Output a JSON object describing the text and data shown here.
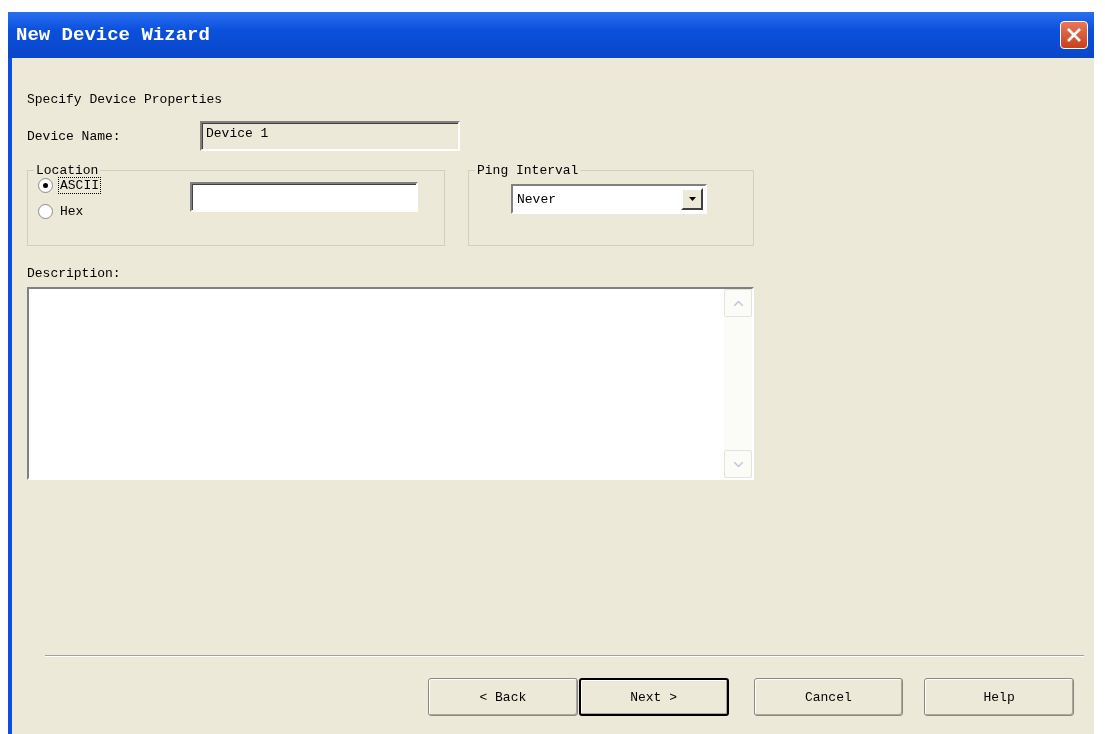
{
  "window": {
    "title": "New Device Wizard"
  },
  "heading": "Specify Device Properties",
  "device_name": {
    "label": "Device Name:",
    "value": "Device 1",
    "disabled": true
  },
  "location": {
    "label": "Location",
    "options": [
      {
        "label": "ASCII",
        "selected": true,
        "focused": true
      },
      {
        "label": "Hex",
        "selected": false,
        "focused": false
      }
    ]
  },
  "ping_interval": {
    "label": "Ping Interval",
    "value": "Never"
  },
  "description": {
    "label": "Description:"
  },
  "buttons": [
    {
      "label": "< Back",
      "default": false
    },
    {
      "label": "Next >",
      "default": true
    },
    {
      "label": "Cancel",
      "default": false
    },
    {
      "label": "Help",
      "default": false
    }
  ]
}
